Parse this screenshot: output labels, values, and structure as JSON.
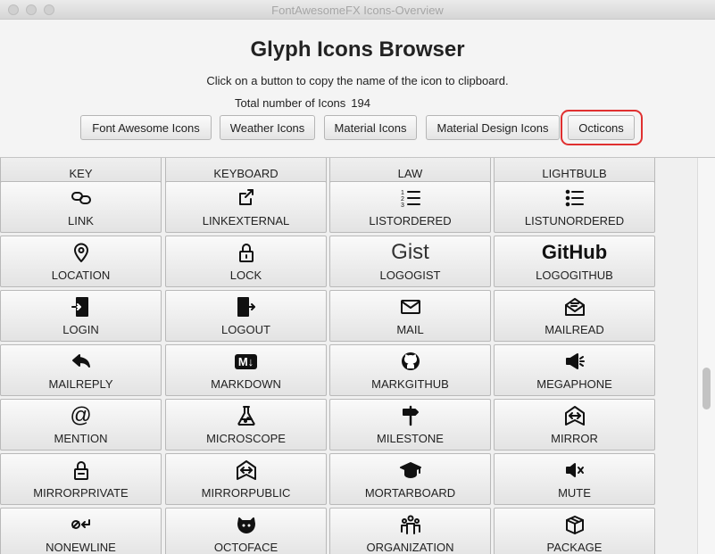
{
  "window": {
    "title": "FontAwesomeFX Icons-Overview"
  },
  "header": {
    "title": "Glyph Icons Browser",
    "subtitle": "Click on a button to copy the name of the icon to clipboard.",
    "total_label": "Total number of Icons",
    "total_count": "194"
  },
  "tabs": [
    {
      "label": "Font Awesome Icons"
    },
    {
      "label": "Weather Icons"
    },
    {
      "label": "Material Icons"
    },
    {
      "label": "Material Design Icons"
    },
    {
      "label": "Octicons",
      "active": true
    }
  ],
  "accent_color": "#e03030",
  "icons": [
    {
      "label": "KEY",
      "icon": "key-icon"
    },
    {
      "label": "KEYBOARD",
      "icon": "keyboard-icon"
    },
    {
      "label": "LAW",
      "icon": "law-icon"
    },
    {
      "label": "LIGHTBULB",
      "icon": "lightbulb-icon"
    },
    {
      "label": "LINK",
      "icon": "link-icon"
    },
    {
      "label": "LINKEXTERNAL",
      "icon": "link-external-icon"
    },
    {
      "label": "LISTORDERED",
      "icon": "list-ordered-icon"
    },
    {
      "label": "LISTUNORDERED",
      "icon": "list-unordered-icon"
    },
    {
      "label": "LOCATION",
      "icon": "location-icon"
    },
    {
      "label": "LOCK",
      "icon": "lock-icon"
    },
    {
      "label": "LOGOGIST",
      "icon": "logo-gist-icon",
      "glyph_text": "Gist"
    },
    {
      "label": "LOGOGITHUB",
      "icon": "logo-github-icon",
      "glyph_text": "GitHub"
    },
    {
      "label": "LOGIN",
      "icon": "sign-in-icon"
    },
    {
      "label": "LOGOUT",
      "icon": "sign-out-icon"
    },
    {
      "label": "MAIL",
      "icon": "mail-icon"
    },
    {
      "label": "MAILREAD",
      "icon": "mail-read-icon"
    },
    {
      "label": "MAILREPLY",
      "icon": "mail-reply-icon"
    },
    {
      "label": "MARKDOWN",
      "icon": "markdown-icon",
      "glyph_text": "M↓"
    },
    {
      "label": "MARKGITHUB",
      "icon": "mark-github-icon"
    },
    {
      "label": "MEGAPHONE",
      "icon": "megaphone-icon"
    },
    {
      "label": "MENTION",
      "icon": "mention-icon",
      "glyph_text": "@"
    },
    {
      "label": "MICROSCOPE",
      "icon": "microscope-icon"
    },
    {
      "label": "MILESTONE",
      "icon": "milestone-icon"
    },
    {
      "label": "MIRROR",
      "icon": "mirror-icon"
    },
    {
      "label": "MIRRORPRIVATE",
      "icon": "mirror-private-icon"
    },
    {
      "label": "MIRRORPUBLIC",
      "icon": "mirror-public-icon"
    },
    {
      "label": "MORTARBOARD",
      "icon": "mortarboard-icon"
    },
    {
      "label": "MUTE",
      "icon": "mute-icon"
    },
    {
      "label": "NONEWLINE",
      "icon": "no-newline-icon"
    },
    {
      "label": "OCTOFACE",
      "icon": "octoface-icon"
    },
    {
      "label": "ORGANIZATION",
      "icon": "organization-icon"
    },
    {
      "label": "PACKAGE",
      "icon": "package-icon"
    }
  ]
}
